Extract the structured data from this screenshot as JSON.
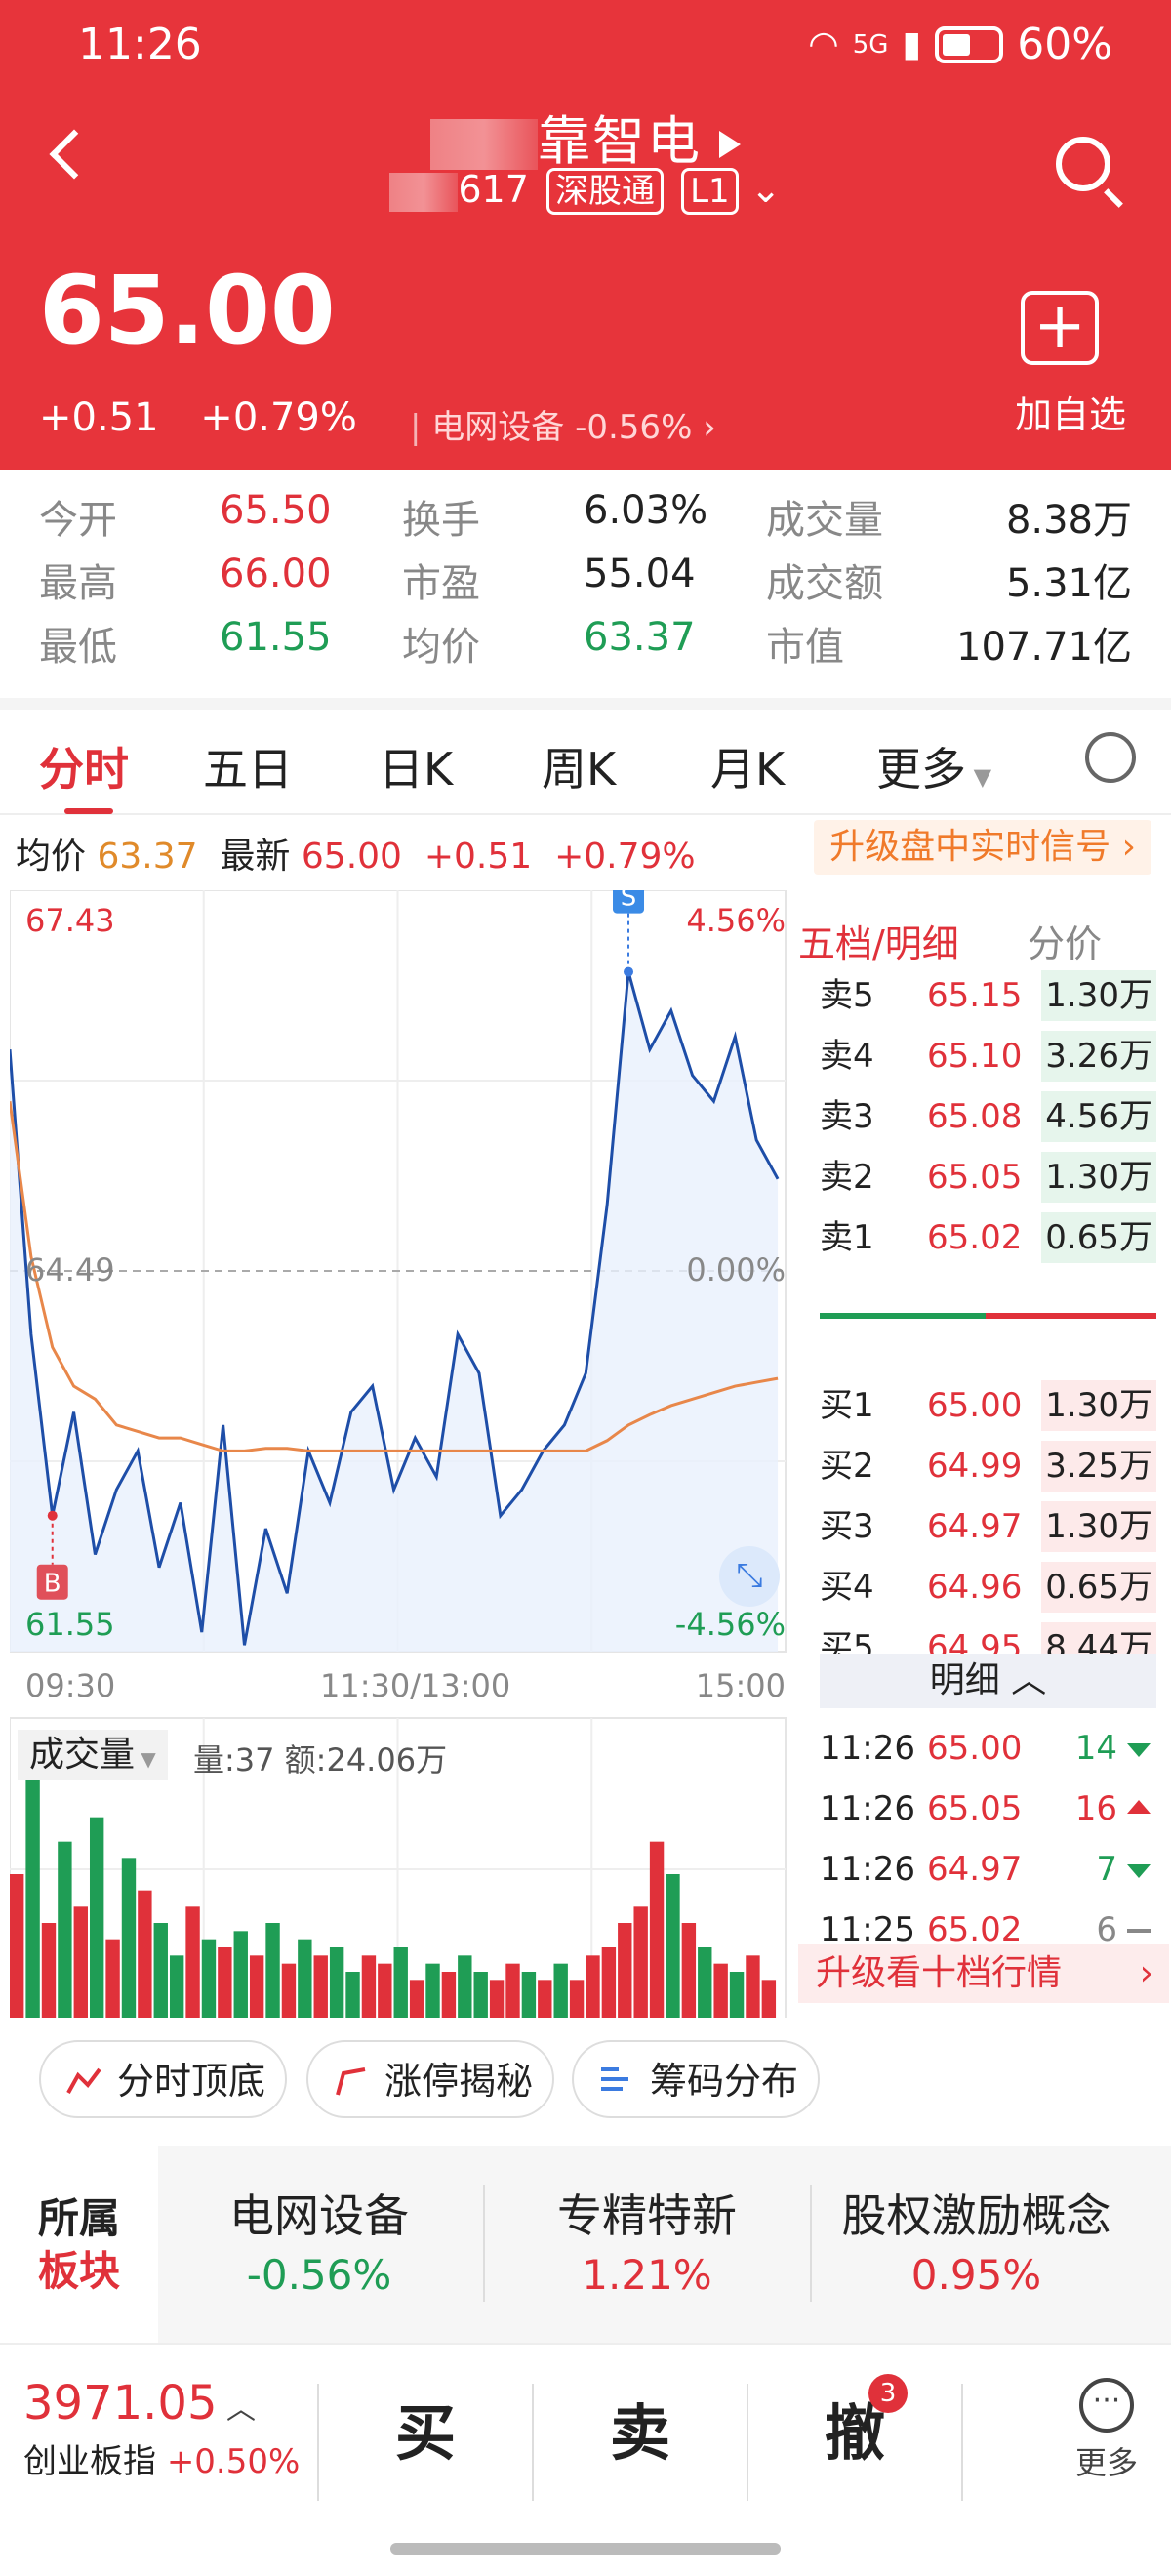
{
  "status_bar": {
    "time": "11:26",
    "network": "5G",
    "battery": "60%"
  },
  "header": {
    "stock_name": "靠智电",
    "code": "617",
    "tag1": "深股通",
    "tag2": "L1",
    "price": "65.00",
    "change": "+0.51",
    "change_pct": "+0.79%",
    "sector": "电网设备",
    "sector_pct": "-0.56%",
    "add_watch": "加自选"
  },
  "stats": {
    "open_label": "今开",
    "open": "65.50",
    "high_label": "最高",
    "high": "66.00",
    "low_label": "最低",
    "low": "61.55",
    "turnover_label": "换手",
    "turnover": "6.03%",
    "pe_label": "市盈",
    "pe": "55.04",
    "avg_label": "均价",
    "avg": "63.37",
    "vol_label": "成交量",
    "vol": "8.38万",
    "amount_label": "成交额",
    "amount": "5.31亿",
    "mcap_label": "市值",
    "mcap": "107.71亿"
  },
  "tabs": [
    "分时",
    "五日",
    "日K",
    "周K",
    "月K",
    "更多"
  ],
  "info_line": {
    "avg_label": "均价",
    "avg": "63.37",
    "latest_label": "最新",
    "latest": "65.00",
    "chg": "+0.51",
    "pct": "+0.79%",
    "upgrade": "升级盘中实时信号"
  },
  "chart_data": {
    "type": "line",
    "y_top": "67.43",
    "y_mid": "64.49",
    "y_bottom": "61.55",
    "pct_top": "4.56%",
    "pct_mid": "0.00%",
    "pct_bottom": "-4.56%",
    "x_labels": [
      "09:30",
      "11:30/13:00",
      "15:00"
    ],
    "ylim": [
      61.55,
      67.43
    ],
    "price_series": [
      66.2,
      64.0,
      62.6,
      63.4,
      62.3,
      62.8,
      63.1,
      62.2,
      62.7,
      61.7,
      63.3,
      61.6,
      62.5,
      62.0,
      63.1,
      62.7,
      63.4,
      63.6,
      62.8,
      63.2,
      62.9,
      64.0,
      63.7,
      62.6,
      62.8,
      63.1,
      63.3,
      63.7,
      65.0,
      66.8,
      66.2,
      66.5,
      66.0,
      65.8,
      66.3,
      65.5,
      65.2
    ],
    "avg_series": [
      65.8,
      64.6,
      63.9,
      63.6,
      63.5,
      63.3,
      63.25,
      63.2,
      63.2,
      63.15,
      63.1,
      63.1,
      63.12,
      63.12,
      63.1,
      63.1,
      63.1,
      63.1,
      63.1,
      63.1,
      63.1,
      63.1,
      63.1,
      63.1,
      63.1,
      63.1,
      63.1,
      63.1,
      63.18,
      63.3,
      63.38,
      63.45,
      63.5,
      63.55,
      63.6,
      63.63,
      63.66
    ],
    "markers": [
      "S",
      "B"
    ],
    "volume_label": "成交量",
    "volume_text": "量:37 额:24.06万",
    "volume_values": [
      18,
      30,
      12,
      22,
      14,
      25,
      10,
      20,
      16,
      12,
      8,
      14,
      10,
      9,
      11,
      8,
      12,
      7,
      10,
      8,
      9,
      6,
      8,
      7,
      9,
      5,
      7,
      6,
      8,
      6,
      5,
      7,
      6,
      5,
      7,
      5,
      8,
      9,
      12,
      14,
      22,
      18,
      12,
      9,
      7,
      6,
      8,
      5
    ],
    "volume_colors": [
      "r",
      "g",
      "r",
      "g",
      "r",
      "g",
      "r",
      "g",
      "r",
      "g",
      "g",
      "r",
      "g",
      "r",
      "g",
      "r",
      "g",
      "r",
      "g",
      "r",
      "g",
      "g",
      "r",
      "r",
      "g",
      "r",
      "g",
      "r",
      "g",
      "g",
      "r",
      "r",
      "g",
      "r",
      "g",
      "r",
      "r",
      "r",
      "r",
      "r",
      "r",
      "g",
      "r",
      "g",
      "r",
      "g",
      "r",
      "r"
    ]
  },
  "panel": {
    "tab1": "五档/明细",
    "tab2": "分价",
    "asks": [
      {
        "label": "卖5",
        "price": "65.15",
        "vol": "1.30万"
      },
      {
        "label": "卖4",
        "price": "65.10",
        "vol": "3.26万"
      },
      {
        "label": "卖3",
        "price": "65.08",
        "vol": "4.56万"
      },
      {
        "label": "卖2",
        "price": "65.05",
        "vol": "1.30万"
      },
      {
        "label": "卖1",
        "price": "65.02",
        "vol": "0.65万"
      }
    ],
    "bids": [
      {
        "label": "买1",
        "price": "65.00",
        "vol": "1.30万"
      },
      {
        "label": "买2",
        "price": "64.99",
        "vol": "3.25万"
      },
      {
        "label": "买3",
        "price": "64.97",
        "vol": "1.30万"
      },
      {
        "label": "买4",
        "price": "64.96",
        "vol": "0.65万"
      },
      {
        "label": "买5",
        "price": "64.95",
        "vol": "8.44万"
      }
    ],
    "detail_label": "明细",
    "ticks": [
      {
        "time": "11:26",
        "price": "65.00",
        "vol": "14",
        "dir": "down"
      },
      {
        "time": "11:26",
        "price": "65.05",
        "vol": "16",
        "dir": "up"
      },
      {
        "time": "11:26",
        "price": "64.97",
        "vol": "7",
        "dir": "down"
      },
      {
        "time": "11:25",
        "price": "65.02",
        "vol": "6",
        "dir": "flat"
      }
    ],
    "upgrade10": "升级看十档行情"
  },
  "tools": [
    "分时顶底",
    "涨停揭秘",
    "筹码分布"
  ],
  "blocks": {
    "label1": "所属",
    "label2": "板块",
    "items": [
      {
        "name": "电网设备",
        "value": "-0.56%"
      },
      {
        "name": "专精特新",
        "value": "1.21%"
      },
      {
        "name": "股权激励概念",
        "value": "0.95%"
      }
    ]
  },
  "bottom": {
    "index_value": "3971.05",
    "index_name": "创业板指",
    "index_pct": "+0.50%",
    "buy": "买",
    "sell": "卖",
    "cancel": "撤",
    "cancel_badge": "3",
    "more": "更多"
  }
}
